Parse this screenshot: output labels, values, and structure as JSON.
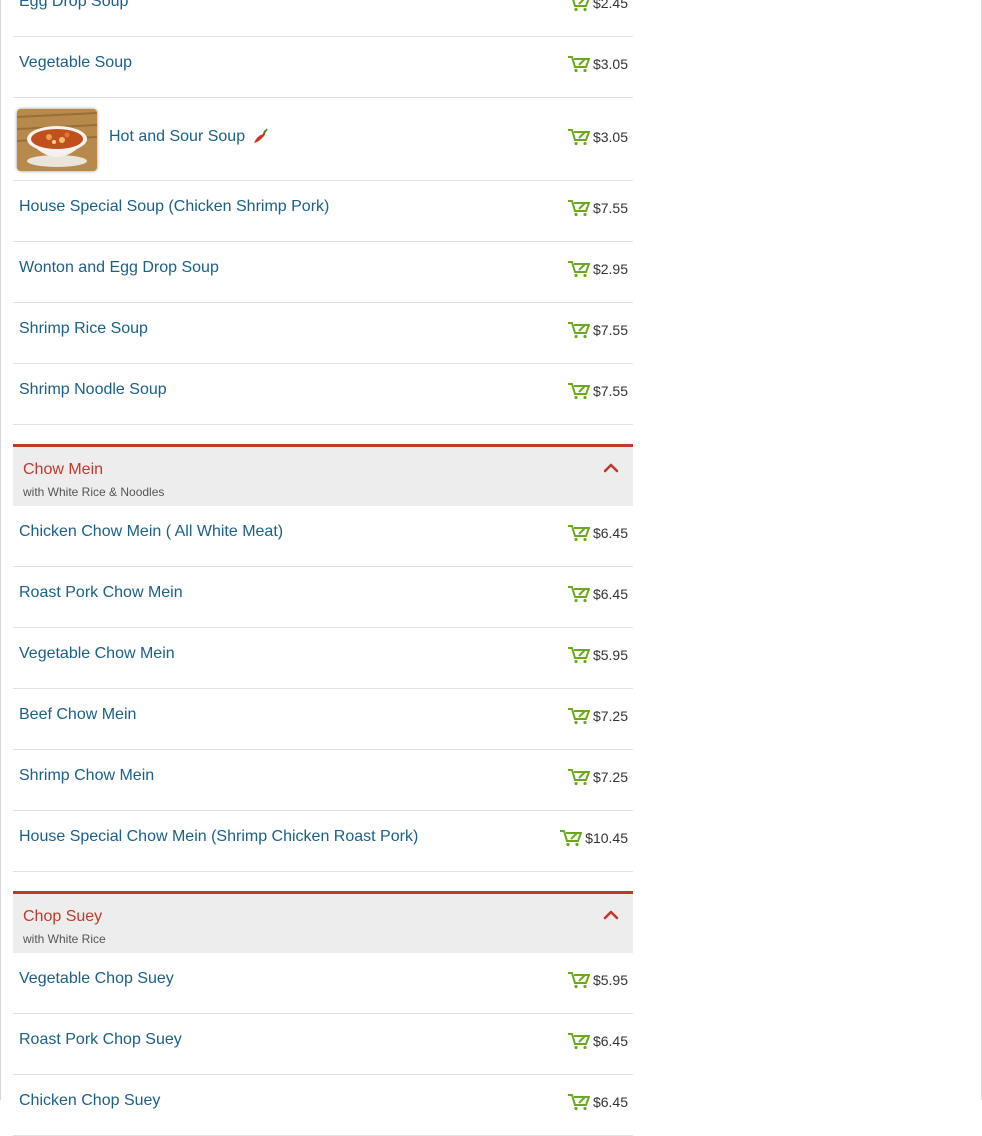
{
  "colors": {
    "item_link": "#1a6088",
    "section_title": "#c0392b",
    "cart_icon": "#6aa81f",
    "price_text": "#333333"
  },
  "sections": [
    {
      "title": "",
      "items": [
        {
          "name": "Egg Drop Soup",
          "price": "$2.45"
        },
        {
          "name": "Vegetable Soup",
          "price": "$3.05"
        },
        {
          "name": "Hot and Sour Soup",
          "price": "$3.05",
          "spicy": true,
          "has_image": true
        },
        {
          "name": "House Special Soup (Chicken Shrimp Pork)",
          "price": "$7.55"
        },
        {
          "name": "Wonton and Egg Drop Soup",
          "price": "$2.95"
        },
        {
          "name": "Shrimp Rice Soup",
          "price": "$7.55"
        },
        {
          "name": "Shrimp Noodle Soup",
          "price": "$7.55"
        }
      ]
    },
    {
      "title": "Chow Mein",
      "subtitle": "with White Rice & Noodles",
      "items": [
        {
          "name": "Chicken Chow Mein ( All White Meat)",
          "price": "$6.45"
        },
        {
          "name": "Roast Pork Chow Mein",
          "price": "$6.45"
        },
        {
          "name": "Vegetable Chow Mein",
          "price": "$5.95"
        },
        {
          "name": "Beef Chow Mein",
          "price": "$7.25"
        },
        {
          "name": "Shrimp Chow Mein",
          "price": "$7.25"
        },
        {
          "name": "House Special Chow Mein (Shrimp Chicken Roast Pork)",
          "price": "$10.45"
        }
      ]
    },
    {
      "title": "Chop Suey",
      "subtitle": "with White Rice",
      "items": [
        {
          "name": "Vegetable Chop Suey",
          "price": "$5.95"
        },
        {
          "name": "Roast Pork Chop Suey",
          "price": "$6.45"
        },
        {
          "name": "Chicken Chop Suey",
          "price": "$6.45"
        }
      ]
    }
  ],
  "icons": {
    "cart": "shopping-cart-icon",
    "spicy": "chili-pepper-icon",
    "collapse": "chevron-up-icon"
  }
}
